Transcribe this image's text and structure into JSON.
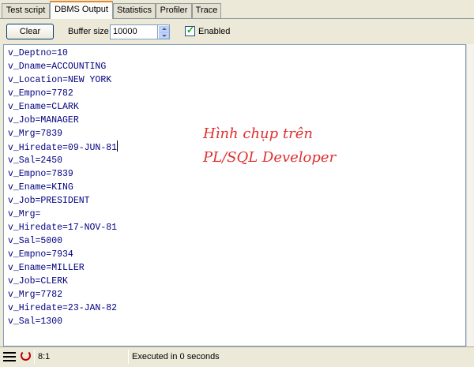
{
  "tabs": [
    {
      "label": "Test script",
      "active": false
    },
    {
      "label": "DBMS Output",
      "active": true
    },
    {
      "label": "Statistics",
      "active": false
    },
    {
      "label": "Profiler",
      "active": false
    },
    {
      "label": "Trace",
      "active": false
    }
  ],
  "toolbar": {
    "clear_label": "Clear",
    "buffer_size_label": "Buffer size",
    "buffer_size_value": "10000",
    "enabled_label": "Enabled",
    "enabled_checked": true
  },
  "output": {
    "lines": [
      "v_Deptno=10",
      "v_Dname=ACCOUNTING",
      "v_Location=NEW YORK",
      "v_Empno=7782",
      "v_Ename=CLARK",
      "v_Job=MANAGER",
      "v_Mrg=7839",
      "v_Hiredate=09-JUN-81",
      "v_Sal=2450",
      "v_Empno=7839",
      "v_Ename=KING",
      "v_Job=PRESIDENT",
      "v_Mrg=",
      "v_Hiredate=17-NOV-81",
      "v_Sal=5000",
      "v_Empno=7934",
      "v_Ename=MILLER",
      "v_Job=CLERK",
      "v_Mrg=7782",
      "v_Hiredate=23-JAN-82",
      "v_Sal=1300"
    ],
    "annotation_line1": "Hình chụp trên",
    "annotation_line2": "PL/SQL Developer"
  },
  "status": {
    "cursor_position": "8:1",
    "message": "Executed in 0 seconds"
  },
  "colors": {
    "output_text": "#000080",
    "annotation": "#e03030",
    "active_tab_accent": "#e68b2c"
  }
}
